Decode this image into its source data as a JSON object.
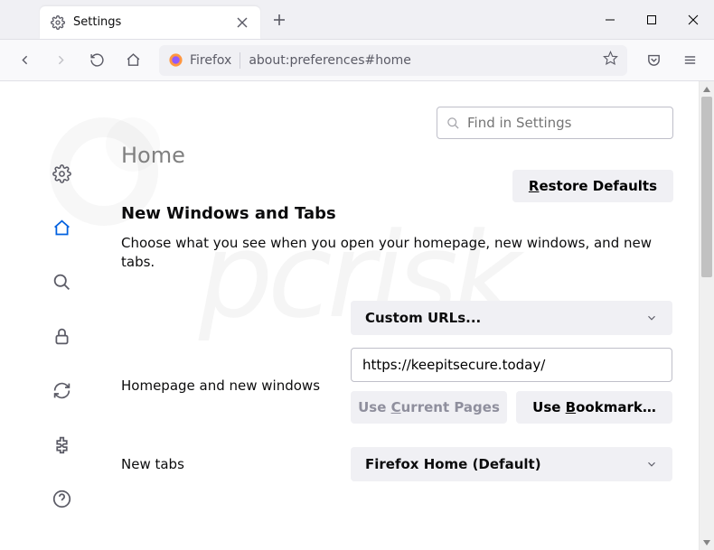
{
  "tab": {
    "title": "Settings"
  },
  "urlbar": {
    "identity": "Firefox",
    "url": "about:preferences#home"
  },
  "search": {
    "placeholder": "Find in Settings"
  },
  "heading": "Home",
  "restore": {
    "pre": "R",
    "rest": "estore Defaults"
  },
  "section": {
    "title": "New Windows and Tabs",
    "desc": "Choose what you see when you open your homepage, new windows, and new tabs."
  },
  "homepage": {
    "label": "Homepage and new windows",
    "select": "Custom URLs...",
    "input": "https://keepitsecure.today/",
    "useCurrent": {
      "pre": "Use ",
      "u": "C",
      "post": "urrent Pages"
    },
    "useBookmark": {
      "pre": "Use ",
      "u": "B",
      "post": "ookmark…"
    }
  },
  "newtabs": {
    "label": "New tabs",
    "select": "Firefox Home (Default)"
  }
}
